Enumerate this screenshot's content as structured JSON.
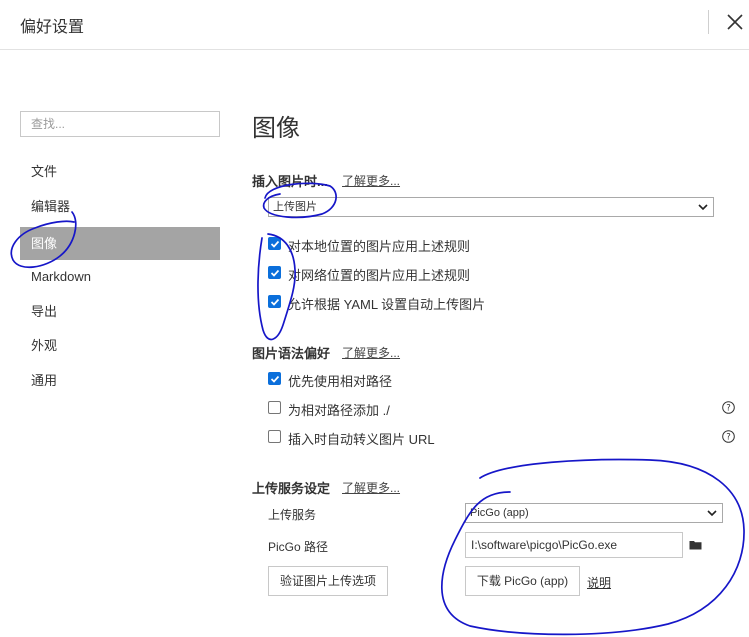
{
  "window": {
    "title": "偏好设置"
  },
  "sidebar": {
    "search_placeholder": "查找...",
    "items": [
      {
        "label": "文件"
      },
      {
        "label": "编辑器"
      },
      {
        "label": "图像",
        "active": true
      },
      {
        "label": "Markdown"
      },
      {
        "label": "导出"
      },
      {
        "label": "外观"
      },
      {
        "label": "通用"
      }
    ]
  },
  "main": {
    "heading": "图像",
    "insert": {
      "title": "插入图片时...",
      "more": "了解更多...",
      "action_value": "上传图片",
      "options": [
        {
          "label": "对本地位置的图片应用上述规则",
          "checked": true
        },
        {
          "label": "对网络位置的图片应用上述规则",
          "checked": true
        },
        {
          "label": "允许根据 YAML 设置自动上传图片",
          "checked": true
        }
      ]
    },
    "syntax": {
      "title": "图片语法偏好",
      "more": "了解更多...",
      "options": [
        {
          "label": "优先使用相对路径",
          "checked": true
        },
        {
          "label": "为相对路径添加 ./",
          "checked": false
        },
        {
          "label": "插入时自动转义图片 URL",
          "checked": false
        }
      ]
    },
    "upload": {
      "title": "上传服务设定",
      "more": "了解更多...",
      "service_label": "上传服务",
      "service_value": "PicGo (app)",
      "path_label": "PicGo 路径",
      "path_value": "I:\\software\\picgo\\PicGo.exe",
      "verify_button": "验证图片上传选项",
      "download_button": "下载 PicGo (app)",
      "help_link": "说明"
    }
  },
  "colors": {
    "checkbox": "#0b6fdb",
    "active_nav": "#a4a4a4",
    "annotation_ink": "#1616c8"
  },
  "icons": [
    "close-icon",
    "chevron-down-icon",
    "checkmark-icon",
    "help-icon",
    "folder-icon"
  ]
}
